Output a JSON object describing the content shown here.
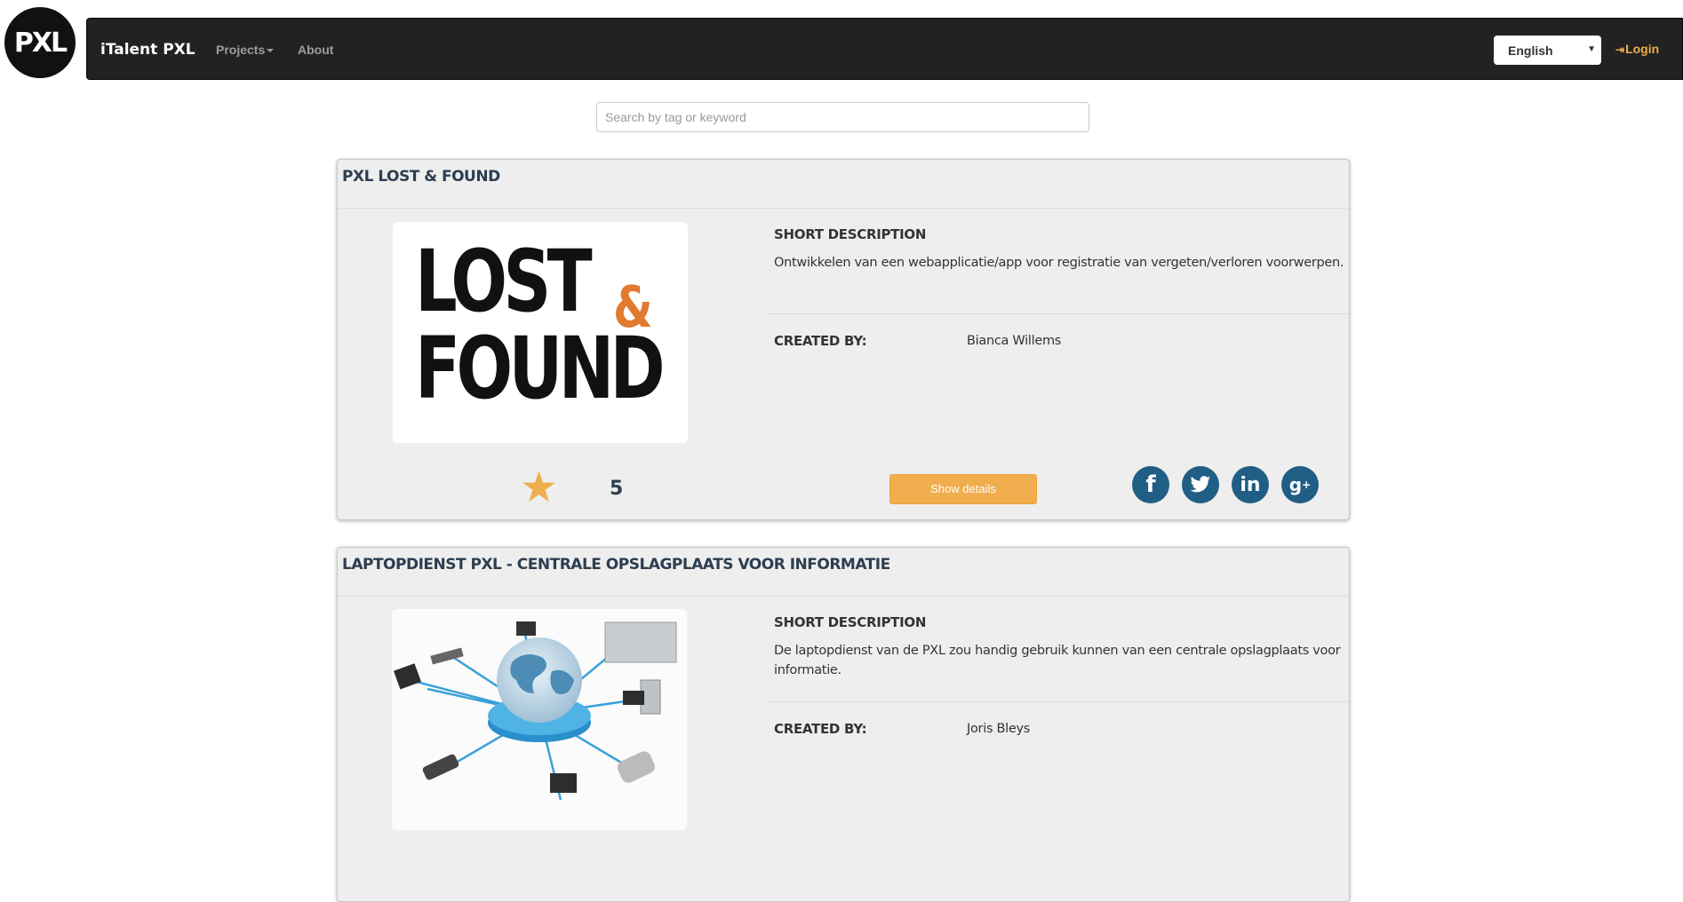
{
  "header": {
    "logo_text": "PXL",
    "brand": "iTalent PXL",
    "nav": {
      "projects": "Projects",
      "about": "About"
    },
    "language": "English",
    "login": "Login"
  },
  "search": {
    "placeholder": "Search by tag or keyword"
  },
  "projects": [
    {
      "title": "PXL LOST & FOUND",
      "image_text": "LOST & FOUND",
      "short_description_label": "SHORT DESCRIPTION",
      "short_description": "Ontwikkelen van een webapplicatie/app voor registratie van vergeten/verloren voorwerpen.",
      "created_by_label": "CREATED BY:",
      "created_by": "Bianca Willems",
      "rating": "5",
      "details_button": "Show details",
      "social_icons": [
        "facebook-icon",
        "twitter-icon",
        "linkedin-icon",
        "google-plus-icon"
      ]
    },
    {
      "title": "LAPTOPDIENST PXL - CENTRALE OPSLAGPLAATS VOOR INFORMATIE",
      "short_description_label": "SHORT DESCRIPTION",
      "short_description": "De laptopdienst van de PXL zou handig gebruik kunnen van een centrale opslagplaats voor informatie.",
      "created_by_label": "CREATED BY:",
      "created_by": "Joris Bleys"
    }
  ],
  "colors": {
    "accent": "#f0ad4e",
    "navbar": "#222222",
    "social": "#215e85",
    "card_bg": "#eeeeee"
  }
}
